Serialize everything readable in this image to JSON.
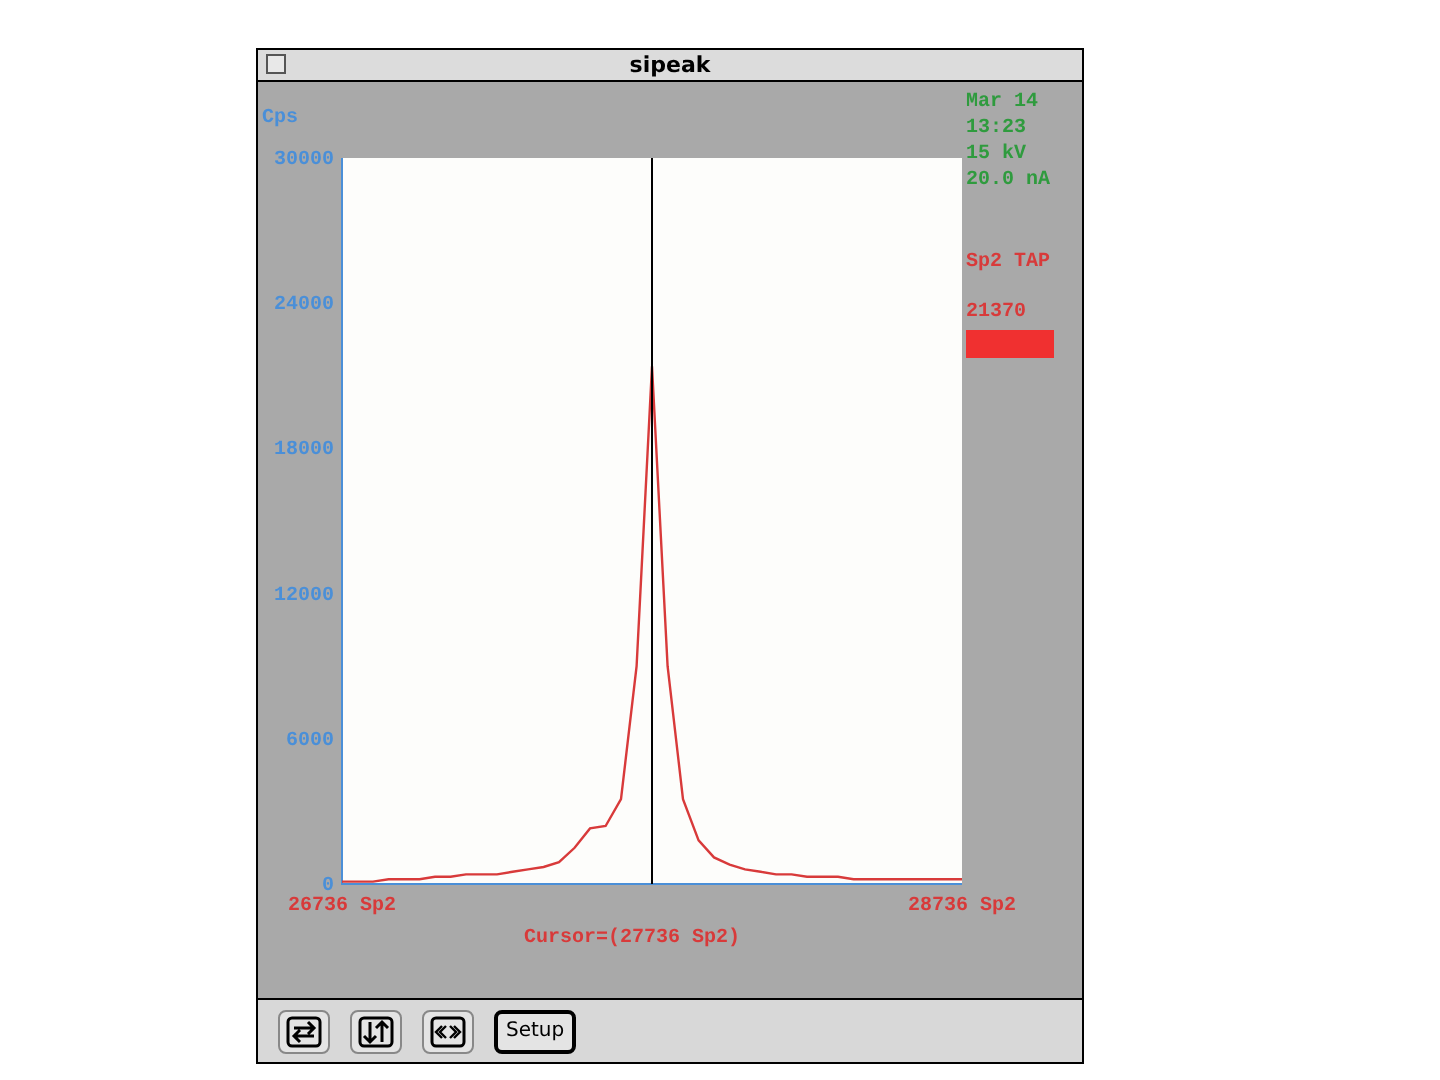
{
  "window": {
    "title": "sipeak"
  },
  "chart": {
    "chart_data": {
      "type": "line",
      "ylabel": "Cps",
      "categories": [
        "26736 Sp2",
        null,
        null,
        null,
        null,
        null,
        null,
        null,
        null,
        null,
        null,
        null,
        null,
        null,
        null,
        null,
        null,
        null,
        null,
        null,
        null,
        null,
        null,
        null,
        null,
        null,
        null,
        null,
        null,
        null,
        null,
        null,
        null,
        null,
        null,
        null,
        null,
        null,
        null,
        null,
        "28736 Sp2"
      ],
      "series": [
        {
          "name": "Sp2 TAP",
          "color": "#d83a3a",
          "values": [
            100,
            100,
            100,
            200,
            200,
            200,
            300,
            300,
            400,
            400,
            400,
            500,
            600,
            700,
            900,
            1500,
            2300,
            2400,
            3500,
            9000,
            21400,
            9000,
            3500,
            1800,
            1100,
            800,
            600,
            500,
            400,
            400,
            300,
            300,
            300,
            200,
            200,
            200,
            200,
            200,
            200,
            200,
            200
          ]
        }
      ],
      "ylim": [
        0,
        30000
      ],
      "yticks": [
        0,
        6000,
        12000,
        18000,
        24000,
        30000
      ]
    },
    "cursor_label": "Cursor=(27736 Sp2)"
  },
  "status": {
    "date": "Mar 14",
    "time": "13:23",
    "voltage": "15 kV",
    "current": "20.0 nA",
    "count": "21370"
  },
  "toolbar": [
    {
      "kind": "swap"
    },
    {
      "kind": "updown"
    },
    {
      "kind": "scroll"
    },
    {
      "kind": "text",
      "label": "Setup"
    }
  ]
}
